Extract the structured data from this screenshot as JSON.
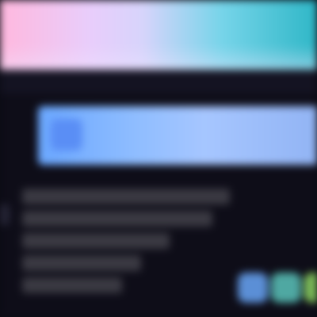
{
  "colors": {
    "wallpaper_left": "#ffb8de",
    "wallpaper_right": "#2fb7c7",
    "window_bg": "#0e0d18",
    "banner_bg": "#8fbdff",
    "banner_text": "#3c63d6",
    "text_block": "#3a3942"
  },
  "banner": {
    "icon": "app-icon",
    "title": "",
    "subtitle": ""
  },
  "body": {
    "lines": [
      "",
      "",
      "",
      "",
      ""
    ]
  },
  "app_icons": [
    {
      "icon": "app-icon-blue",
      "color": "#5b8fd6"
    },
    {
      "icon": "app-icon-teal",
      "color": "#4fa8a2"
    },
    {
      "icon": "app-icon-green",
      "color": "#7fbf5a"
    }
  ]
}
